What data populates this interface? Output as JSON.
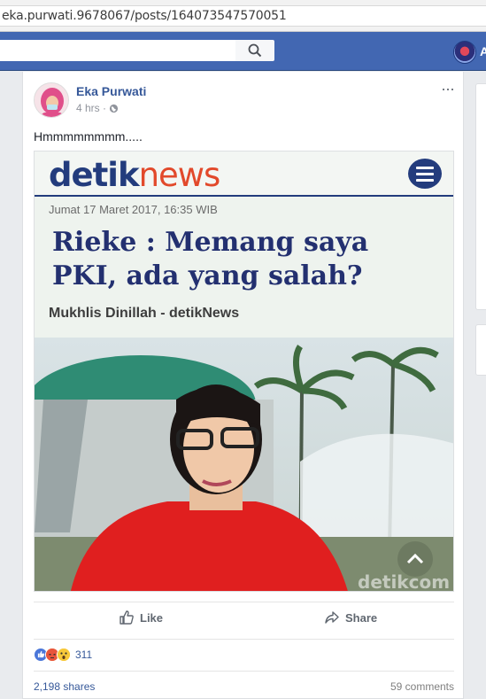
{
  "browser": {
    "url": "eka.purwati.9678067/posts/164073547570051"
  },
  "topbar": {
    "search_icon": "search-icon",
    "profile_name": "A"
  },
  "post": {
    "author": "Eka Purwati",
    "time": "4 hrs ·",
    "privacy_icon": "globe-icon",
    "text": "Hmmmmmmmm.....",
    "more_icon": "more-icon",
    "more_text": "···"
  },
  "shared_image": {
    "logo_part1": "detik",
    "logo_part2": "news",
    "date": "Jumat 17 Maret 2017, 16:35 WIB",
    "headline": "Rieke : Memang saya PKI, ada yang salah?",
    "byline": "Mukhlis Dinillah - detikNews",
    "watermark": "detikcom",
    "colors": {
      "brand_blue": "#233c7d",
      "brand_red": "#e2492b"
    }
  },
  "actions": {
    "like": "Like",
    "share": "Share"
  },
  "reactions": {
    "count": "311",
    "types": [
      "like",
      "angry",
      "wow"
    ]
  },
  "stats": {
    "shares": "2,198 shares",
    "comments": "59 comments"
  },
  "colors": {
    "fb_blue": "#4267b2",
    "link": "#365899"
  }
}
